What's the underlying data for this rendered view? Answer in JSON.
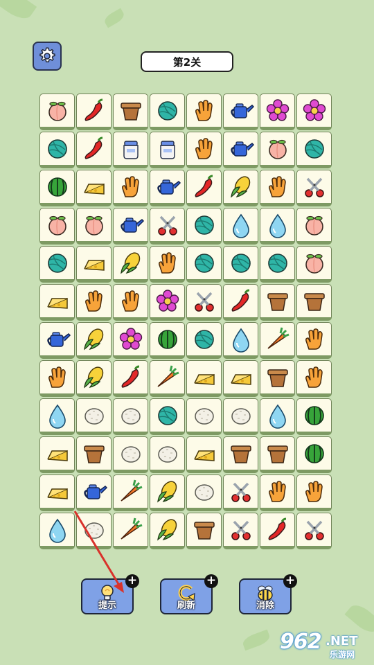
{
  "level": {
    "title": "第2关"
  },
  "settings": {
    "icon": "gear-icon"
  },
  "board": {
    "rows": [
      [
        "peach",
        "pepper",
        "pot",
        "yarn",
        "glove",
        "watering-can",
        "flower",
        "flower"
      ],
      [
        "yarn",
        "pepper",
        "jar",
        "jar",
        "glove",
        "watering-can",
        "peach",
        "yarn"
      ],
      [
        "watermelon",
        "cheese",
        "glove",
        "watering-can",
        "pepper",
        "corn",
        "glove",
        "scissors"
      ],
      [
        "peach",
        "peach",
        "watering-can",
        "scissors",
        "yarn",
        "drop",
        "drop",
        "peach"
      ],
      [
        "yarn",
        "cheese",
        "corn",
        "glove",
        "yarn",
        "yarn",
        "yarn",
        "peach"
      ],
      [
        "cheese",
        "glove",
        "glove",
        "flower",
        "scissors",
        "pepper",
        "pot",
        "pot"
      ],
      [
        "watering-can",
        "corn",
        "flower",
        "watermelon",
        "yarn",
        "drop",
        "carrot",
        "glove"
      ],
      [
        "glove",
        "corn",
        "pepper",
        "carrot",
        "cheese",
        "cheese",
        "pot",
        "glove"
      ],
      [
        "drop",
        "rice",
        "rice",
        "yarn",
        "rice",
        "rice",
        "drop",
        "watermelon"
      ],
      [
        "cheese",
        "pot",
        "rice",
        "rice",
        "cheese",
        "pot",
        "pot",
        "watermelon"
      ],
      [
        "cheese",
        "watering-can",
        "carrot",
        "corn",
        "rice",
        "scissors",
        "glove",
        "glove"
      ],
      [
        "drop",
        "rice",
        "carrot",
        "corn",
        "pot",
        "scissors",
        "pepper",
        "scissors"
      ]
    ]
  },
  "actions": [
    {
      "label": "提示",
      "icon": "lightbulb-icon"
    },
    {
      "label": "刷新",
      "icon": "refresh-icon"
    },
    {
      "label": "消除",
      "icon": "bee-icon"
    }
  ],
  "plus_symbol": "+",
  "watermark": {
    "number": "962",
    "suffix": ".NET",
    "cn": "乐游网"
  },
  "colors": {
    "accent_button": "#7fa1e6",
    "tile_face": "#fdfbe8",
    "background": "#c9e0b6",
    "arrow": "#d9322b"
  }
}
